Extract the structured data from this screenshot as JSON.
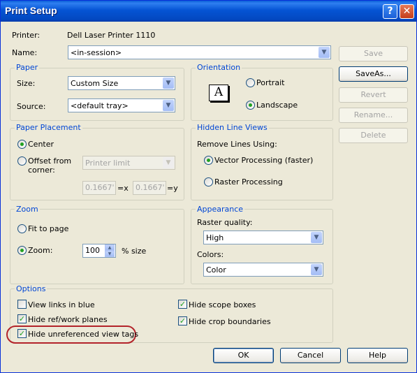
{
  "window": {
    "title": "Print Setup"
  },
  "printer": {
    "label": "Printer:",
    "value": "Dell Laser Printer 1110"
  },
  "name": {
    "label": "Name:",
    "value": "<in-session>"
  },
  "side_buttons": {
    "save": "Save",
    "save_as": "SaveAs...",
    "revert": "Revert",
    "rename": "Rename...",
    "delete": "Delete"
  },
  "paper": {
    "title": "Paper",
    "size_label": "Size:",
    "size_value": "Custom Size",
    "source_label": "Source:",
    "source_value": "<default tray>"
  },
  "orientation": {
    "title": "Orientation",
    "portrait": "Portrait",
    "landscape": "Landscape",
    "icon_letter": "A",
    "selected": "Landscape"
  },
  "placement": {
    "title": "Paper Placement",
    "center": "Center",
    "offset": "Offset from",
    "offset_line2": "corner:",
    "corner_value": "Printer limit",
    "x_value": "0.1667'",
    "x_suffix": "=x",
    "y_value": "0.1667'",
    "y_suffix": "=y",
    "selected": "Center"
  },
  "hidden_lines": {
    "title": "Hidden Line Views",
    "remove_label": "Remove Lines Using:",
    "vector": "Vector Processing (faster)",
    "raster": "Raster Processing",
    "selected": "Vector Processing (faster)"
  },
  "zoom": {
    "title": "Zoom",
    "fit": "Fit to page",
    "zoom_label": "Zoom:",
    "zoom_value": "100",
    "size_suffix": "% size",
    "selected": "Zoom"
  },
  "appearance": {
    "title": "Appearance",
    "raster_label": "Raster quality:",
    "raster_value": "High",
    "colors_label": "Colors:",
    "colors_value": "Color"
  },
  "options": {
    "title": "Options",
    "view_links": {
      "label": "View links in blue",
      "checked": false
    },
    "hide_ref": {
      "label": "Hide ref/work planes",
      "checked": true
    },
    "hide_unref": {
      "label": "Hide unreferenced view tags",
      "checked": true
    },
    "hide_scope": {
      "label": "Hide scope boxes",
      "checked": true
    },
    "hide_crop": {
      "label": "Hide crop boundaries",
      "checked": true
    }
  },
  "footer": {
    "ok": "OK",
    "cancel": "Cancel",
    "help": "Help"
  },
  "colors": {
    "title_bar": "#0554d4",
    "group_title": "#0046d5",
    "highlight_ring": "#b3232a",
    "dialog_bg": "#ece9d8"
  }
}
